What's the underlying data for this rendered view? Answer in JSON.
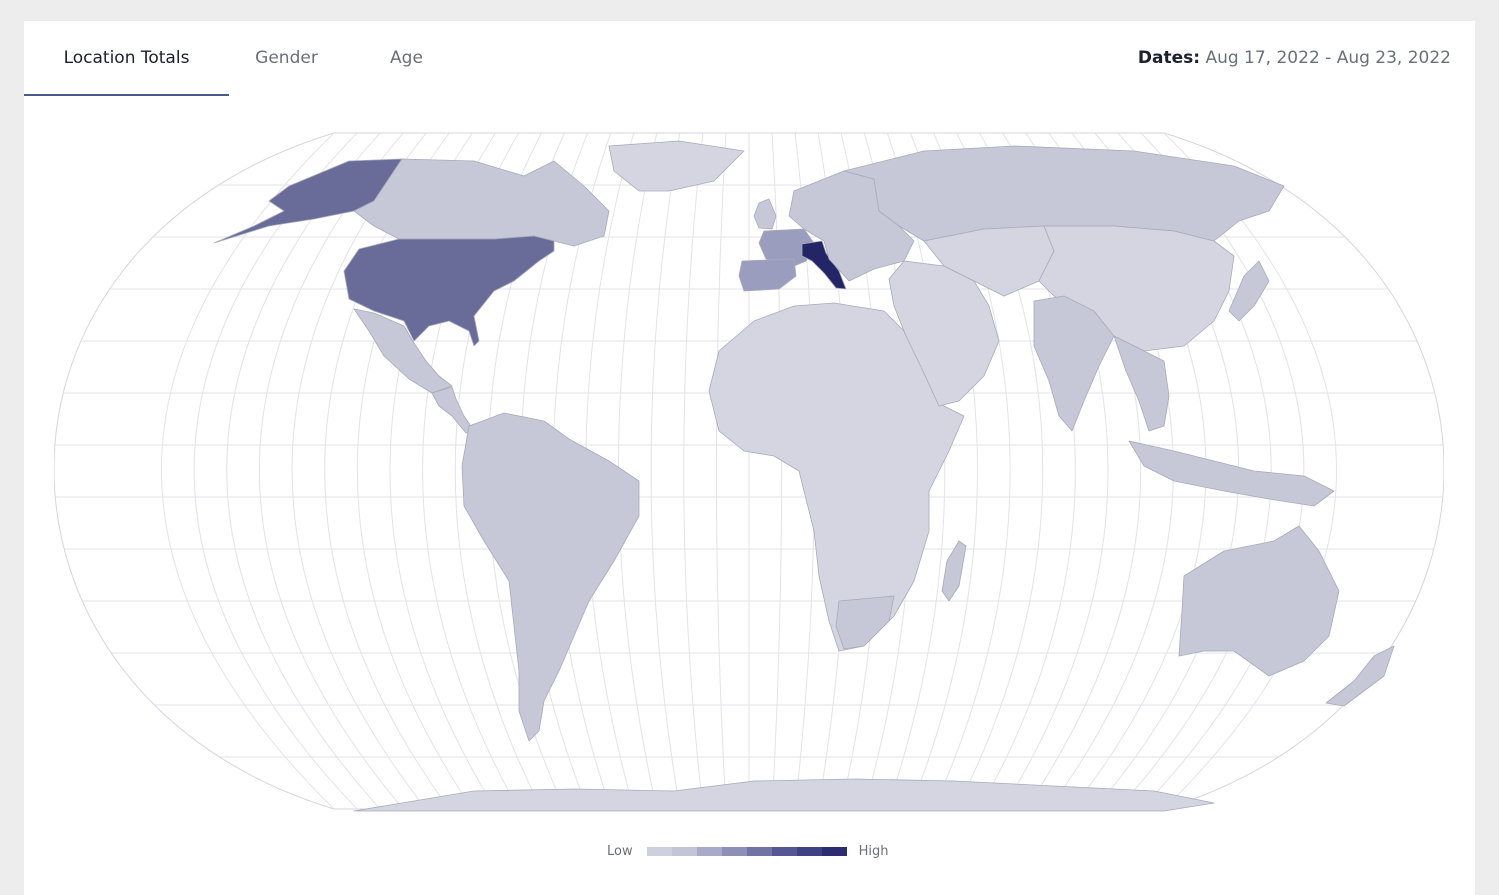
{
  "tabs": [
    {
      "label": "Location Totals",
      "active": true
    },
    {
      "label": "Gender",
      "active": false
    },
    {
      "label": "Age",
      "active": false
    }
  ],
  "dates": {
    "label": "Dates:",
    "value": "Aug 17, 2022 - Aug 23, 2022"
  },
  "legend": {
    "low_label": "Low",
    "high_label": "High",
    "colors": [
      "#cfd0de",
      "#c3c4d6",
      "#a9aac7",
      "#8d8fb6",
      "#7073a4",
      "#545794",
      "#3e4285",
      "#2a2d72"
    ]
  },
  "colors": {
    "grid": "#e3e3e8",
    "border": "#a8aabb",
    "low": "#d4d5e0",
    "level1": "#c6c8d8",
    "level2": "#9b9dbf",
    "level3": "#696b98",
    "high": "#232566"
  },
  "regions": [
    {
      "name": "Alaska",
      "level": "level3"
    },
    {
      "name": "Canada",
      "level": "level1"
    },
    {
      "name": "Greenland",
      "level": "low"
    },
    {
      "name": "United States",
      "level": "level3"
    },
    {
      "name": "Mexico",
      "level": "level1"
    },
    {
      "name": "Central America",
      "level": "level1"
    },
    {
      "name": "South America",
      "level": "level1"
    },
    {
      "name": "Africa",
      "level": "low"
    },
    {
      "name": "France",
      "level": "level2"
    },
    {
      "name": "Spain",
      "level": "level2"
    },
    {
      "name": "Italy",
      "level": "high"
    },
    {
      "name": "United Kingdom",
      "level": "level1"
    },
    {
      "name": "Europe",
      "level": "level1"
    },
    {
      "name": "Russia",
      "level": "level1"
    },
    {
      "name": "Middle East",
      "level": "low"
    },
    {
      "name": "Central Asia",
      "level": "low"
    },
    {
      "name": "China",
      "level": "low"
    },
    {
      "name": "India",
      "level": "level1"
    },
    {
      "name": "Southeast Asia",
      "level": "level1"
    },
    {
      "name": "Indonesia",
      "level": "level1"
    },
    {
      "name": "Japan",
      "level": "level1"
    },
    {
      "name": "Australia",
      "level": "level1"
    },
    {
      "name": "New Zealand",
      "level": "level1"
    },
    {
      "name": "Madagascar",
      "level": "level1"
    },
    {
      "name": "South Africa",
      "level": "level1"
    },
    {
      "name": "Antarctica",
      "level": "low"
    }
  ]
}
